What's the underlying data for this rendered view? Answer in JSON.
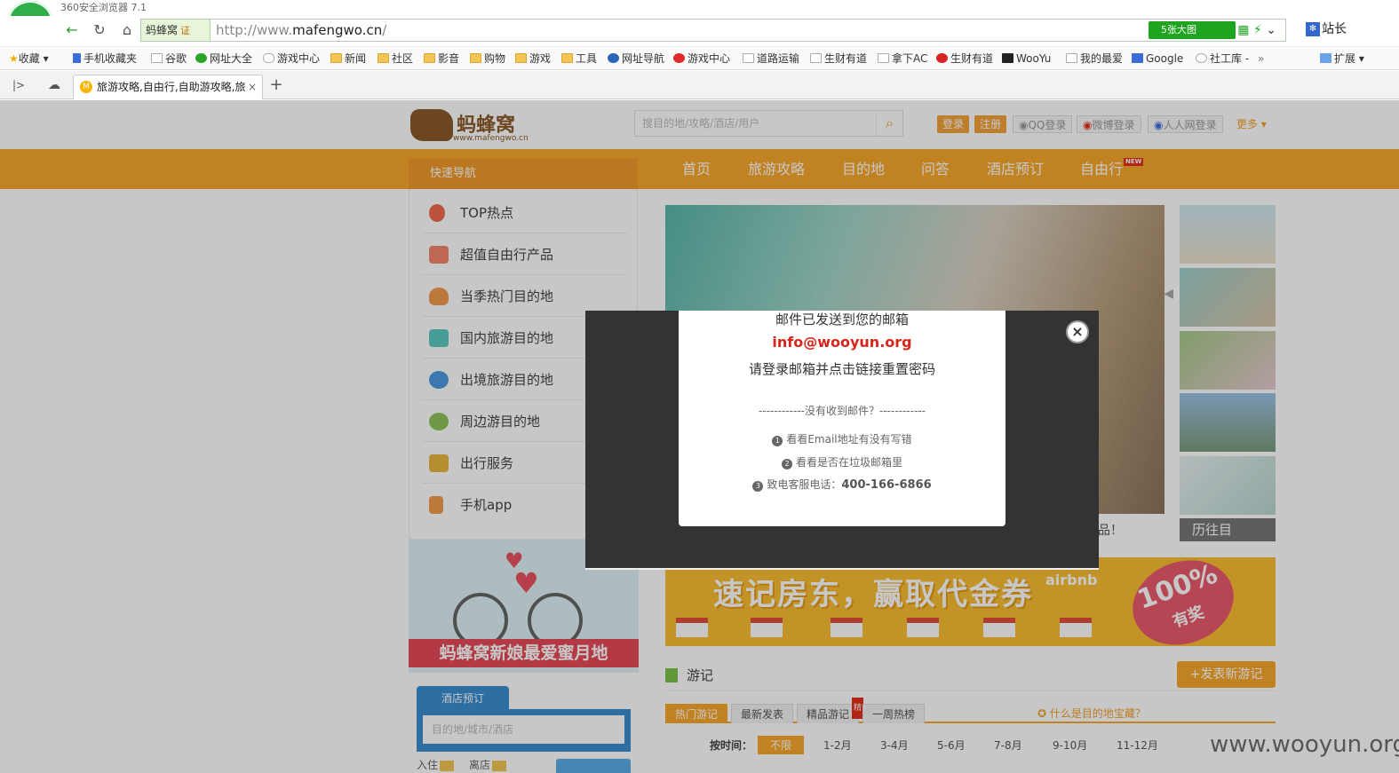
{
  "browser": {
    "app_title": "360安全浏览器 7.1",
    "site_badge": "蚂蜂窝",
    "cert": "证",
    "url_prefix": "http://www.",
    "url_domain": "mafengwo.cn",
    "url_suffix": "/",
    "big_pic_label": "5张大图",
    "zhanzhang": "站长",
    "bookmarks": [
      "收藏",
      "手机收藏夹",
      "谷歌",
      "网址大全",
      "游戏中心",
      "新闻",
      "社区",
      "影音",
      "购物",
      "游戏",
      "工具",
      "网址导航",
      "游戏中心",
      "道路运输",
      "生财有道",
      "拿下AC",
      "生财有道",
      "WooYu",
      "我的最爱",
      "Google",
      "社工库 -",
      "扩展"
    ],
    "tab_title": "旅游攻略,自由行,自助游攻略,旅"
  },
  "page": {
    "search_placeholder": "搜目的地/攻略/酒店/用户",
    "login": "登录",
    "register": "注册",
    "qq_login": "QQ登录",
    "weibo_login": "微博登录",
    "renren_login": "人人网登录",
    "more": "更多",
    "quick_nav": "快速导航",
    "logo_text": "蚂蜂窝",
    "logo_sub": "www.mafengwo.cn",
    "nav": [
      "首页",
      "旅游攻略",
      "目的地",
      "问答",
      "酒店预订",
      "自由行"
    ],
    "new_badge": "NEW",
    "side_items": [
      "TOP热点",
      "超值自由行产品",
      "当季热门目的地",
      "国内旅游目的地",
      "出境旅游目的地",
      "周边游目的地",
      "出行服务",
      "手机app"
    ],
    "banner_text": "蚂蜂窝新娘最爱蜜月地",
    "hotel_tab": "酒店预订",
    "hotel_placeholder": "目的地/城市/酒店",
    "bottom_hint_a": "入住",
    "bottom_hint_b": "离店",
    "hero_caption": "品！",
    "past_label": "历往目",
    "ad_text": "速记房东，赢取代金券",
    "ad_brand": "airbnb",
    "ad_percent": "100%",
    "ad_prize": "有奖",
    "travel_title": "游记",
    "post_btn": "+发表新游记",
    "travel_tabs": [
      "热门游记",
      "最新发表",
      "精品游记",
      "一周热榜"
    ],
    "jing": "精",
    "what_link": "什么是目的地宝藏？",
    "by_time": "按时间：",
    "months": [
      "不限",
      "1-2月",
      "3-4月",
      "5-6月",
      "7-8月",
      "9-10月",
      "11-12月"
    ]
  },
  "modal": {
    "line1": "邮件已发送到您的邮箱",
    "email": "info@wooyun.org",
    "line2": "请登录邮箱并点击链接重置密码",
    "separator": "------------没有收到邮件？------------",
    "tip1": "看看Email地址有没有写错",
    "tip2": "看看是否在垃圾邮箱里",
    "tip3_label": "致电客服电话：",
    "tip3_phone": "400-166-6866",
    "close": "×"
  },
  "watermark": "www.wooyun.org"
}
